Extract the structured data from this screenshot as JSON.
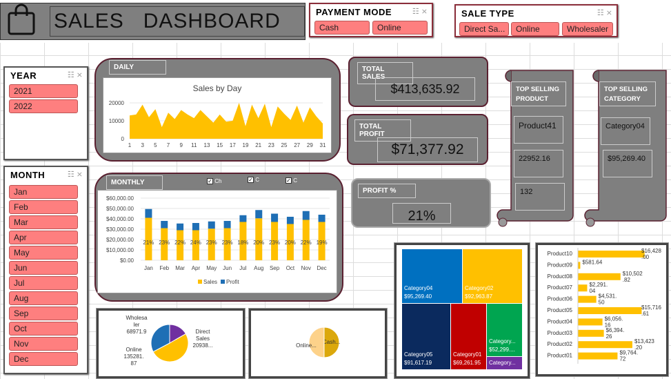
{
  "header": {
    "title": "SALES   DASHBOARD",
    "icon": "shopping-bag-icon"
  },
  "payment_mode": {
    "title": "PAYMENT MODE",
    "items": [
      "Cash",
      "Online"
    ]
  },
  "sale_type": {
    "title": "SALE TYPE",
    "items": [
      "Direct Sa...",
      "Online",
      "Wholesaler"
    ]
  },
  "year": {
    "title": "YEAR",
    "items": [
      "2021",
      "2022"
    ]
  },
  "month": {
    "title": "MONTH",
    "items": [
      "Jan",
      "Feb",
      "Mar",
      "Apr",
      "May",
      "Jun",
      "Jul",
      "Aug",
      "Sep",
      "Oct",
      "Nov",
      "Dec"
    ]
  },
  "daily": {
    "tag": "DAILY",
    "title": "Sales by Day"
  },
  "monthly": {
    "tag": "MONTHLY",
    "checks": [
      "Ch",
      "C",
      "C"
    ],
    "legend_sales": "Sales",
    "legend_profit": "Profit"
  },
  "kpi": {
    "total_sales_label": "TOTAL SALES",
    "total_sales": "$413,635.92",
    "total_profit_label": "TOTAL PROFIT",
    "total_profit": "$71,377.92",
    "profit_pct_label": "PROFIT %",
    "profit_pct": "21%"
  },
  "top_product": {
    "label": "TOP SELLING PRODUCT",
    "name": "Product41",
    "value": "22952.16",
    "qty": "132"
  },
  "top_category": {
    "label": "TOP SELLING CATEGORY",
    "name": "Category04",
    "value": "$95,269.40"
  },
  "colors": {
    "accent": "#ffc000",
    "profit": "#1f6fb5",
    "chip": "#fe7f7f",
    "panel": "#7f7f7f"
  },
  "chart_data": [
    {
      "type": "area",
      "title": "Sales by Day",
      "x": [
        1,
        2,
        3,
        4,
        5,
        6,
        7,
        8,
        9,
        10,
        11,
        12,
        13,
        14,
        15,
        16,
        17,
        18,
        19,
        20,
        21,
        22,
        23,
        24,
        25,
        26,
        27,
        28,
        29,
        30,
        31
      ],
      "values": [
        13000,
        13500,
        19000,
        12000,
        16500,
        6500,
        14500,
        11000,
        16000,
        13500,
        11500,
        16000,
        12500,
        9000,
        13500,
        9500,
        10000,
        20000,
        7000,
        19000,
        11500,
        19500,
        6500,
        18000,
        14000,
        10500,
        18500,
        9000,
        17500,
        12500,
        8500
      ],
      "ylim": [
        0,
        20000
      ],
      "yticks": [
        "0",
        "10000",
        "20000"
      ],
      "xticks": [
        "1",
        "3",
        "5",
        "7",
        "9",
        "11",
        "13",
        "15",
        "17",
        "19",
        "21",
        "23",
        "25",
        "27",
        "29",
        "31"
      ]
    },
    {
      "type": "bar",
      "categories": [
        "Jan",
        "Feb",
        "Mar",
        "Apr",
        "May",
        "Jun",
        "Jul",
        "Aug",
        "Sep",
        "Oct",
        "Nov",
        "Dec"
      ],
      "series": [
        {
          "name": "Sales",
          "values": [
            41000,
            31000,
            29000,
            29000,
            30500,
            31000,
            37000,
            40500,
            37000,
            35000,
            39000,
            37000
          ]
        },
        {
          "name": "Profit",
          "values": [
            8500,
            7000,
            6500,
            7000,
            7000,
            7000,
            6500,
            8000,
            8000,
            7000,
            8500,
            7000
          ]
        }
      ],
      "labels": [
        "21%",
        "23%",
        "22%",
        "24%",
        "23%",
        "23%",
        "18%",
        "20%",
        "23%",
        "20%",
        "22%",
        "19%"
      ],
      "ylim": [
        0,
        60000
      ],
      "yticks": [
        "$0.00",
        "$10,000.00",
        "$20,000.00",
        "$30,000.00",
        "$40,000.00",
        "$50,000.00",
        "$60,000.00"
      ]
    },
    {
      "type": "pie",
      "slices": [
        {
          "name": "Wholesaler",
          "value": 68971.9,
          "label": "Wholesa\nler\n68971.9"
        },
        {
          "name": "Direct Sales",
          "value": 209382,
          "label": "Direct\nSales\n20938..."
        },
        {
          "name": "Online",
          "value": 135281.87,
          "label": "Online\n135281.\n87"
        }
      ]
    },
    {
      "type": "pie",
      "slices": [
        {
          "name": "Cash",
          "value": 207000,
          "label": "Cash..."
        },
        {
          "name": "Online",
          "value": 206600,
          "label": "Online..."
        }
      ]
    },
    {
      "type": "heatmap",
      "cells": [
        {
          "name": "Category04",
          "value": "$95,269.40",
          "color": "#0070c0"
        },
        {
          "name": "Category02",
          "value": "$92,963.87",
          "color": "#ffc000"
        },
        {
          "name": "Category05",
          "value": "$91,617.19",
          "color": "#0b2a5e"
        },
        {
          "name": "Category01",
          "value": "$69,261.95",
          "color": "#c00000"
        },
        {
          "name": "Category...",
          "value": "$52,299....",
          "color": "#00a550"
        },
        {
          "name": "Category...",
          "value": "",
          "color": "#7030a0"
        }
      ]
    },
    {
      "type": "bar",
      "orientation": "horizontal",
      "categories": [
        "Product10",
        "Product09",
        "Product08",
        "Product07",
        "Product06",
        "Product05",
        "Product04",
        "Product03",
        "Product02",
        "Product01"
      ],
      "values": [
        16428,
        581.64,
        10502.82,
        2291.04,
        4531.5,
        15716.61,
        6056.16,
        6394.26,
        13423.2,
        9764.72
      ],
      "labels": [
        "$16,428\n.00",
        "$581.64",
        "$10,502\n.82",
        "$2,291.\n04",
        "$4,531.\n50",
        "$15,716\n.61",
        "$6,056.\n16",
        "$6,394.\n26",
        "$13,423\n.20",
        "$9,764.\n72"
      ]
    }
  ]
}
